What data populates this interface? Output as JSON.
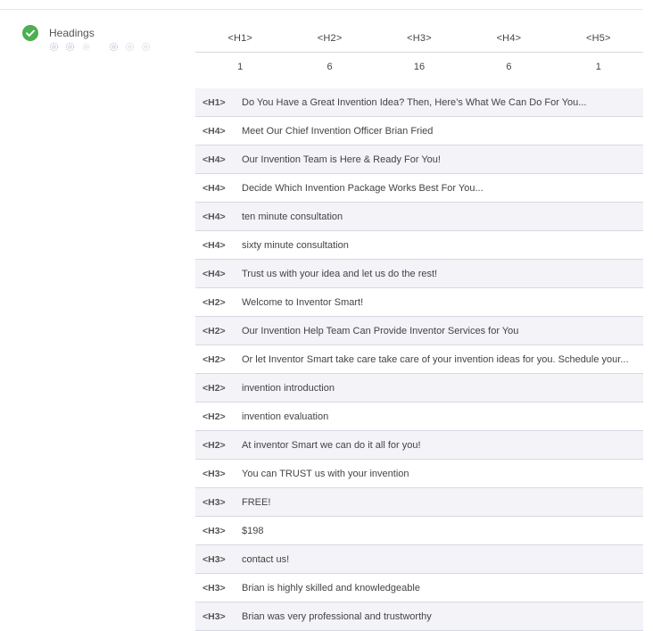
{
  "colors": {
    "success": "#4caf50",
    "stripe": "#f3f3f8",
    "divider": "#d8d8e4"
  },
  "status": {
    "icon": "check-circle-icon",
    "label": "Headings"
  },
  "summary": {
    "headers": [
      "<H1>",
      "<H2>",
      "<H3>",
      "<H4>",
      "<H5>"
    ],
    "counts": [
      "1",
      "6",
      "16",
      "6",
      "1"
    ]
  },
  "headings": [
    {
      "tag": "<H1>",
      "text": "Do You Have a Great Invention Idea? Then, Here’s What We Can Do For You..."
    },
    {
      "tag": "<H4>",
      "text": "Meet Our Chief Invention Officer Brian Fried"
    },
    {
      "tag": "<H4>",
      "text": "Our Invention Team is Here & Ready For You!"
    },
    {
      "tag": "<H4>",
      "text": "Decide Which Invention Package Works Best For You..."
    },
    {
      "tag": "<H4>",
      "text": "ten minute consultation"
    },
    {
      "tag": "<H4>",
      "text": "sixty minute consultation"
    },
    {
      "tag": "<H4>",
      "text": "Trust us with your idea and let us do the rest!"
    },
    {
      "tag": "<H2>",
      "text": "Welcome to Inventor Smart!"
    },
    {
      "tag": "<H2>",
      "text": "Our Invention Help Team Can Provide Inventor Services for You"
    },
    {
      "tag": "<H2>",
      "text": "Or let Inventor Smart take care take care of your invention ideas for you. Schedule your..."
    },
    {
      "tag": "<H2>",
      "text": "invention introduction"
    },
    {
      "tag": "<H2>",
      "text": "invention evaluation"
    },
    {
      "tag": "<H2>",
      "text": "At inventor Smart we can do it all for you!"
    },
    {
      "tag": "<H3>",
      "text": "You can TRUST us with your invention"
    },
    {
      "tag": "<H3>",
      "text": "FREE!"
    },
    {
      "tag": "<H3>",
      "text": "$198"
    },
    {
      "tag": "<H3>",
      "text": "contact us!"
    },
    {
      "tag": "<H3>",
      "text": "Brian is highly skilled and knowledgeable"
    },
    {
      "tag": "<H3>",
      "text": "Brian was very professional and trustworthy"
    }
  ]
}
